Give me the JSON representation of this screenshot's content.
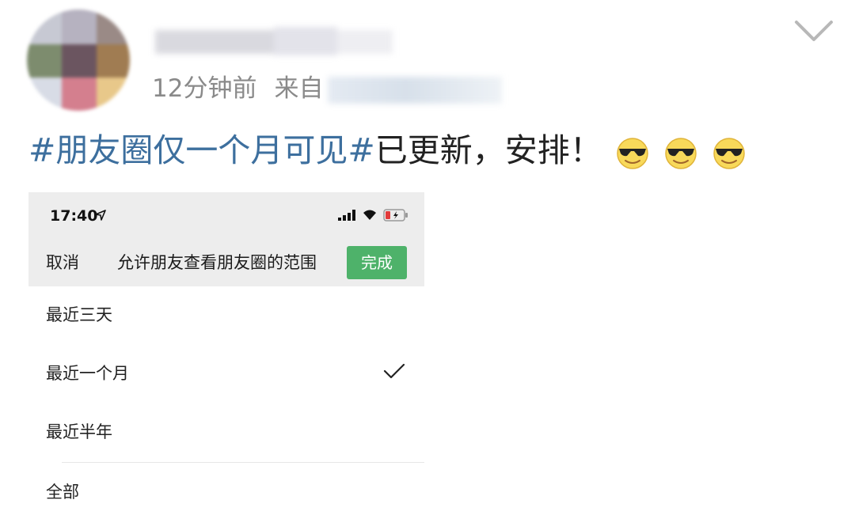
{
  "post": {
    "time": "12分钟前",
    "source_label": "来自",
    "hashtag": "#朋友圈仅一个月可见#",
    "text": "已更新，安排！",
    "emoji": [
      "cool-sunglasses-emoji",
      "cool-sunglasses-emoji",
      "cool-sunglasses-emoji"
    ]
  },
  "phone": {
    "status_time": "17:40",
    "cancel_label": "取消",
    "title": "允许朋友查看朋友圈的范围",
    "done_label": "完成",
    "options": [
      {
        "label": "最近三天",
        "selected": false
      },
      {
        "label": "最近一个月",
        "selected": true
      },
      {
        "label": "最近半年",
        "selected": false
      },
      {
        "label": "全部",
        "selected": false
      }
    ]
  },
  "colors": {
    "hashtag": "#3d6f9e",
    "done_button": "#4eb26a",
    "meta_text": "#8a8a8a",
    "phone_header_bg": "#ededed"
  }
}
